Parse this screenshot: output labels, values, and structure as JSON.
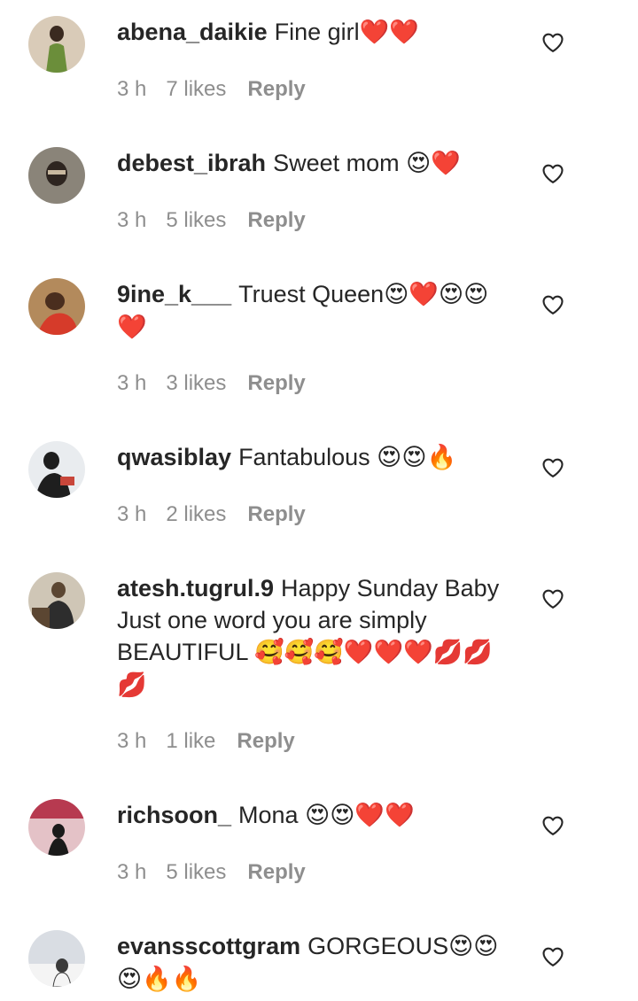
{
  "comments": [
    {
      "username": "abena_daikie",
      "text": "Fine girl",
      "emojis": "❤️❤️",
      "time": "3 h",
      "likes": "7 likes",
      "reply": "Reply",
      "avatar_colors": [
        "#d9cbb8",
        "#3a2a20",
        "#6b8e3a"
      ]
    },
    {
      "username": "debest_ibrah",
      "text": "Sweet mom ",
      "emojis": "😍❤️",
      "time": "3 h",
      "likes": "5 likes",
      "reply": "Reply",
      "avatar_colors": [
        "#8a8479",
        "#2e2520",
        "#c9b9a0"
      ]
    },
    {
      "username": "9ine_k___",
      "text": "Truest Queen",
      "emojis": "😍❤️😍😍❤️",
      "time": "3 h",
      "likes": "3 likes",
      "reply": "Reply",
      "avatar_colors": [
        "#b38a5c",
        "#d63b2a",
        "#4a2e1e"
      ]
    },
    {
      "username": "qwasiblay",
      "text": "Fantabulous ",
      "emojis": "😍😍🔥",
      "time": "3 h",
      "likes": "2 likes",
      "reply": "Reply",
      "avatar_colors": [
        "#e9ecef",
        "#1e1e1e",
        "#c8463a"
      ]
    },
    {
      "username": "atesh.tugrul.9",
      "text": "Happy Sunday Baby Just one word you are simply BEAUTIFUL ",
      "emojis": "🥰🥰🥰❤️❤️❤️💋💋💋",
      "time": "3 h",
      "likes": "1 like",
      "reply": "Reply",
      "avatar_colors": [
        "#cfc6b6",
        "#5b4632",
        "#2d2d2d"
      ]
    },
    {
      "username": "richsoon_",
      "text": "Mona ",
      "emojis": "😍😍❤️❤️",
      "time": "3 h",
      "likes": "5 likes",
      "reply": "Reply",
      "avatar_colors": [
        "#e4c2c7",
        "#b73a50",
        "#1a1a1a"
      ]
    },
    {
      "username": "evansscottgram",
      "text": "GORGEOUS",
      "emojis": "😍😍😍🔥🔥",
      "time": "",
      "likes": "",
      "reply": "",
      "avatar_colors": [
        "#d9dde3",
        "#f4f4f4",
        "#3b3b3b"
      ]
    }
  ],
  "icons": {
    "like": "heart-outline-icon"
  }
}
